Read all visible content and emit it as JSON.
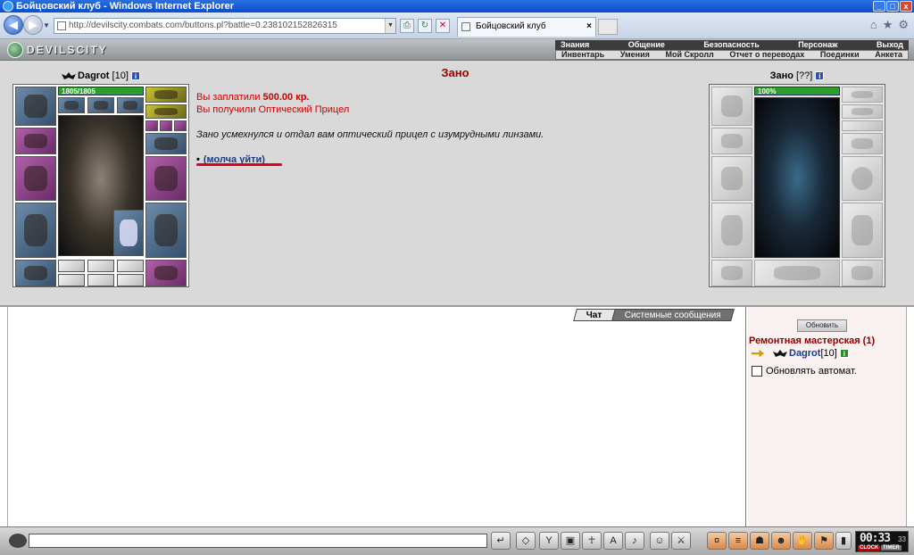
{
  "window": {
    "title": "Бойцовский клуб - Windows Internet Explorer"
  },
  "browser": {
    "address": "http://devilscity.combats.com/buttons.pl?battle=0.238102152826315",
    "tab_title": "Бойцовский клуб",
    "tab_close": "×"
  },
  "game": {
    "logo": "DEVILSCITY",
    "menu_row1": [
      "Знания",
      "Общение",
      "Безопасность",
      "Персонаж",
      "Выход"
    ],
    "menu_row2": [
      "Инвентарь",
      "Умения",
      "Мой Скролл",
      "Отчет о переводах",
      "Поединки",
      "Анкета"
    ]
  },
  "player": {
    "name": "Dagrot",
    "level": "[10]",
    "hp": "1805/1805"
  },
  "npc": {
    "name": "Зано",
    "level": "[??]",
    "hp": "100%"
  },
  "dialog": {
    "title": "Зано",
    "paid_prefix": "Вы заплатили ",
    "paid_amount": "500.00 кр.",
    "received": "Вы получили Оптический Прицел",
    "story": "Зано усмехнулся и отдал вам оптический прицел с изумрудными линзами.",
    "bullet": "•",
    "leave_link": "(молча уйти)"
  },
  "chat": {
    "tab_chat": "Чат",
    "tab_system": "Системные сообщения",
    "refresh_button": "Обновить",
    "room_title": "Ремонтная мастерская (1)",
    "user_name": "Dagrot",
    "user_level": "[10]",
    "auto_refresh": "Обновлять автомат."
  },
  "clock": {
    "time": "00:33",
    "seconds": "33",
    "label_clock": "CLOCK",
    "label_timer": "TIMER"
  }
}
